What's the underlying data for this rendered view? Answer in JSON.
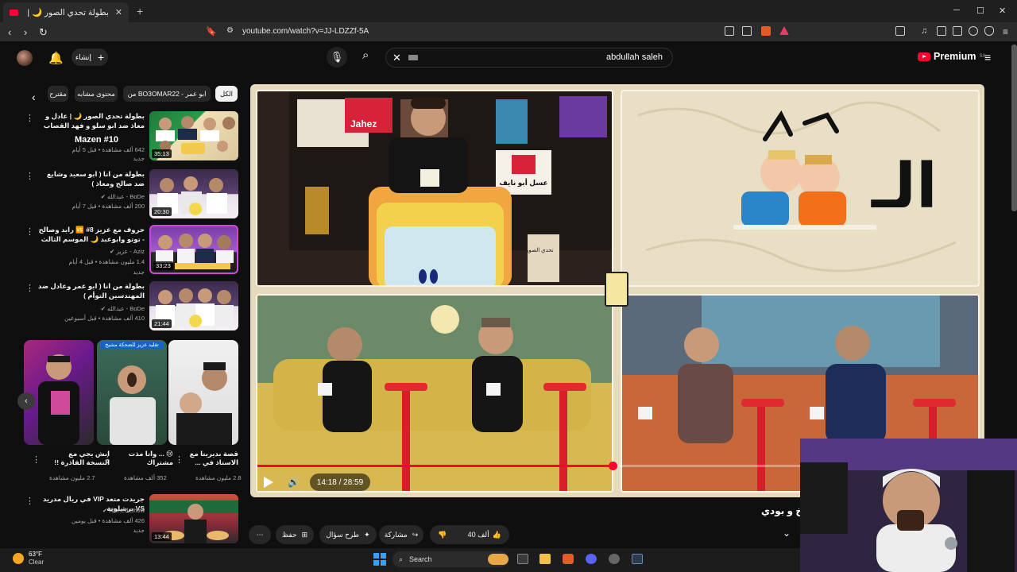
{
  "browser": {
    "tab_title": "بطولة تحدي الصور 🌙 | أبو السعد",
    "new_tab": "+",
    "url": "youtube.com/watch?v=JJ-LDZZf-5A",
    "win_min": "─",
    "win_max": "☐",
    "win_close": "✕"
  },
  "header": {
    "create_label": "إنشاء",
    "search_value": "abdullah saleh",
    "premium_label": "Premium",
    "premium_region": "SA"
  },
  "chips": [
    {
      "label": "الكل"
    },
    {
      "label": "من BO3OMAR22 - ابو عمر"
    },
    {
      "label": "محتوى مشابه"
    },
    {
      "label": "مقترح"
    }
  ],
  "sidebar_videos": [
    {
      "title": "بطولة تحدي الصور 🌙 | عادل و معاذ ضد ابو سلو و فهد القصاب",
      "channel": "Mazen #10",
      "meta": "642 ألف مشاهدة • قبل 5 أيام",
      "badge": "جديد",
      "duration": "35:13"
    },
    {
      "title": "بطولة من انا ( ابو سعيد وشايع ضد صالح ومعاذ )",
      "channel": "BoDe - عبدالله ✔",
      "meta": "200 ألف مشاهدة • قبل 7 أيام",
      "badge": "جديد",
      "duration": "20:30"
    },
    {
      "title": "حروف مع عزيز 8# 🆚 رايد وصالح - توتو وابوعبد 🌙 الموسم الثالث",
      "channel": "Aziz - عزيز ✔",
      "meta": "1.4 مليون مشاهدة • قبل 4 أيام",
      "badge": "جديد",
      "duration": "33:23"
    },
    {
      "title": "بطولة من انا ( ابو عمر وعادل ضد المهندسين التوأم )",
      "channel": "BoDe - عبدالله ✔",
      "meta": "410 ألف مشاهدة • قبل أسبوعين",
      "badge": "",
      "duration": "21:44"
    }
  ],
  "shorts": [
    {
      "title": "قصة بديرينا مع الاستاذ في ...",
      "views": "2.8 مليون مشاهدة"
    },
    {
      "title": "😢 ... وانا مذت مشتراك",
      "views": "352 ألف مشاهدة",
      "label": "تقليد عزيز للضحكة مشيخ"
    },
    {
      "title": "ابش يجي مع النسخة الفاذرة !!",
      "views": "2.7 مليون مشاهدة"
    }
  ],
  "bottom_video": {
    "title": "جريدت متعد VIP في ريال مدريد VS برشلونة",
    "channel": "Ahmed Show ✔",
    "meta": "426 ألف مشاهدة • قبل يومين",
    "badge": "جديد",
    "duration": "13:44"
  },
  "player": {
    "time": "14:18 / 28:59",
    "progress": 0.493,
    "panel_text_al": "الـ",
    "sign_text": "عسل أبو نايف",
    "jahez": "Jahez",
    "shelf_text": "تحدي الصور"
  },
  "below": {
    "title": "خ و بودي",
    "like_count": "40 ألف",
    "share": "مشاركة",
    "ask": "طرح سؤال",
    "save": "حفظ",
    "more": "⋯"
  },
  "taskbar": {
    "temp": "63°F",
    "cond": "Clear",
    "search": "Search"
  },
  "colors": {
    "accent": "#ff0033",
    "bg": "#0f0f0f",
    "chip": "#272727"
  }
}
